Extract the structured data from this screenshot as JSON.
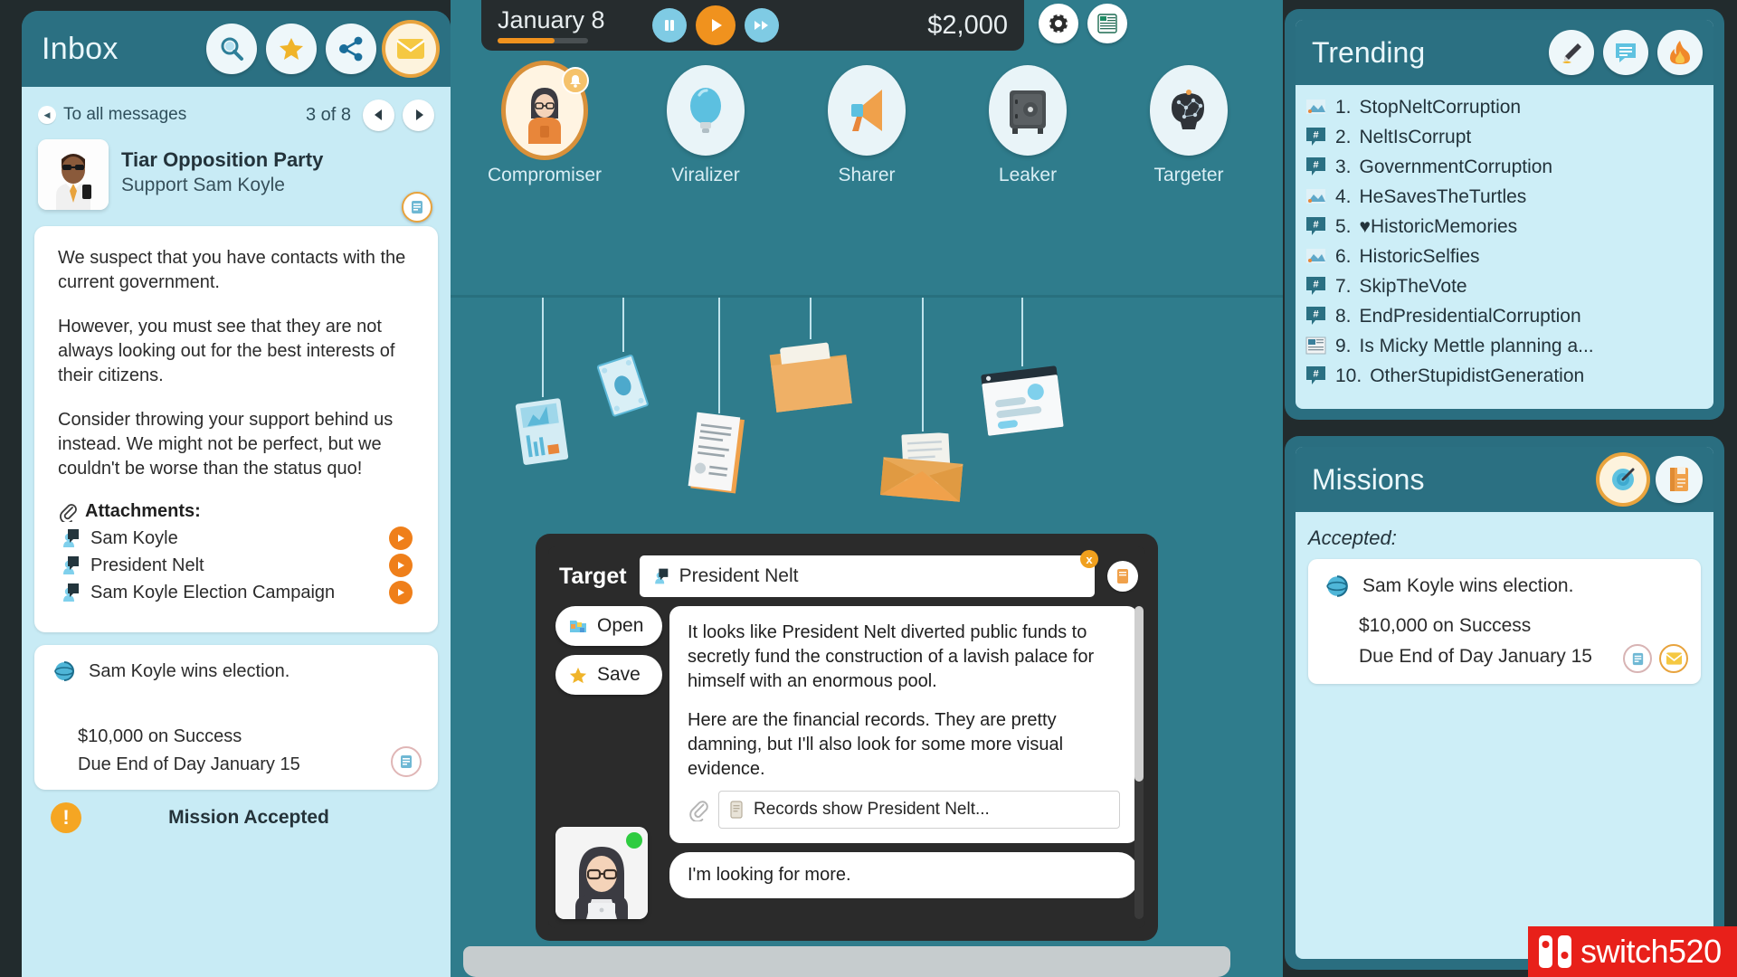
{
  "inbox": {
    "title": "Inbox",
    "header_icons": [
      "search-icon",
      "star-icon",
      "share-icon",
      "envelope-icon"
    ],
    "nav": {
      "back_label": "To all messages",
      "counter": "3 of 8",
      "prev_icon": "chevron-left-icon",
      "next_icon": "chevron-right-icon"
    },
    "message": {
      "sender": "Tiar Opposition Party",
      "subject": "Support Sam Koyle",
      "paragraphs": [
        "We suspect that you have contacts with the current government.",
        "However, you must see that they are not always looking out for the best interests of their citizens.",
        "Consider throwing your support behind us instead. We might not be perfect, but we couldn't be worse than the status quo!"
      ],
      "attachments_label": "Attachments:",
      "attachments": [
        "Sam Koyle",
        "President Nelt",
        "Sam Koyle Election Campaign"
      ]
    },
    "mission": {
      "title": "Sam Koyle wins election.",
      "reward": "$10,000 on Success",
      "due": "Due End of Day January 15"
    },
    "status": "Mission Accepted"
  },
  "topbar": {
    "date": "January 8",
    "money": "$2,000",
    "pause_icon": "pause-icon",
    "play_icon": "play-icon",
    "fast_forward_icon": "fast-forward-icon",
    "settings_icon": "gear-icon",
    "stats_icon": "spreadsheet-icon"
  },
  "actions": [
    {
      "label": "Compromiser",
      "icon": "person-hacker-icon",
      "selected": true,
      "badge": true
    },
    {
      "label": "Viralizer",
      "icon": "lightbulb-icon",
      "selected": false,
      "badge": false
    },
    {
      "label": "Sharer",
      "icon": "megaphone-icon",
      "selected": false,
      "badge": false
    },
    {
      "label": "Leaker",
      "icon": "safe-icon",
      "selected": false,
      "badge": false
    },
    {
      "label": "Targeter",
      "icon": "brain-network-icon",
      "selected": false,
      "badge": false
    }
  ],
  "hangings": [
    {
      "icon": "chart-card-icon"
    },
    {
      "icon": "banknote-icon"
    },
    {
      "icon": "document-icon"
    },
    {
      "icon": "folder-icon"
    },
    {
      "icon": "open-envelope-icon"
    },
    {
      "icon": "browser-window-icon"
    }
  ],
  "laptop": {
    "target_label": "Target",
    "target_value": "President Nelt",
    "close_label": "x",
    "buttons": [
      {
        "label": "Open",
        "icon": "open-folder-icon"
      },
      {
        "label": "Save",
        "icon": "star-icon"
      }
    ],
    "chat": {
      "message_paragraphs": [
        "It looks like President Nelt diverted public funds to secretly fund the construction of a lavish palace for himself with an enormous pool.",
        "Here are the financial records. They are pretty damning, but I'll also look for some more visual evidence."
      ],
      "attachment": "Records show President Nelt...",
      "reply": "I'm looking for more."
    }
  },
  "trending": {
    "title": "Trending",
    "header_icons": [
      "pen-icon",
      "comment-icon",
      "fire-icon"
    ],
    "items": [
      {
        "rank": "1.",
        "text": "StopNeltCorruption",
        "icon": "image-icon"
      },
      {
        "rank": "2.",
        "text": "NeltIsCorrupt",
        "icon": "hashtag-icon"
      },
      {
        "rank": "3.",
        "text": "GovernmentCorruption",
        "icon": "hashtag-icon"
      },
      {
        "rank": "4.",
        "text": "HeSavesTheTurtles",
        "icon": "image-icon"
      },
      {
        "rank": "5.",
        "text": "♥HistoricMemories",
        "icon": "hashtag-icon"
      },
      {
        "rank": "6.",
        "text": "HistoricSelfies",
        "icon": "image-icon"
      },
      {
        "rank": "7.",
        "text": "SkipTheVote",
        "icon": "hashtag-icon"
      },
      {
        "rank": "8.",
        "text": "EndPresidentialCorruption",
        "icon": "hashtag-icon"
      },
      {
        "rank": "9.",
        "text": "Is Micky Mettle planning a...",
        "icon": "article-icon"
      },
      {
        "rank": "10.",
        "text": "OtherStupidistGeneration",
        "icon": "hashtag-icon"
      }
    ]
  },
  "missions": {
    "title": "Missions",
    "header_icons": [
      "target-icon",
      "book-icon"
    ],
    "accepted_label": "Accepted:",
    "items": [
      {
        "title": "Sam Koyle wins election.",
        "reward": "$10,000 on Success",
        "due": "Due End of Day January 15"
      }
    ]
  },
  "watermark": {
    "text": "switch520"
  },
  "colors": {
    "background": "#2f7c8c",
    "panel_header": "#2b7082",
    "panel_body": "#cdeef7",
    "accent_orange": "#f0921e",
    "dark": "#2b2b2b"
  }
}
